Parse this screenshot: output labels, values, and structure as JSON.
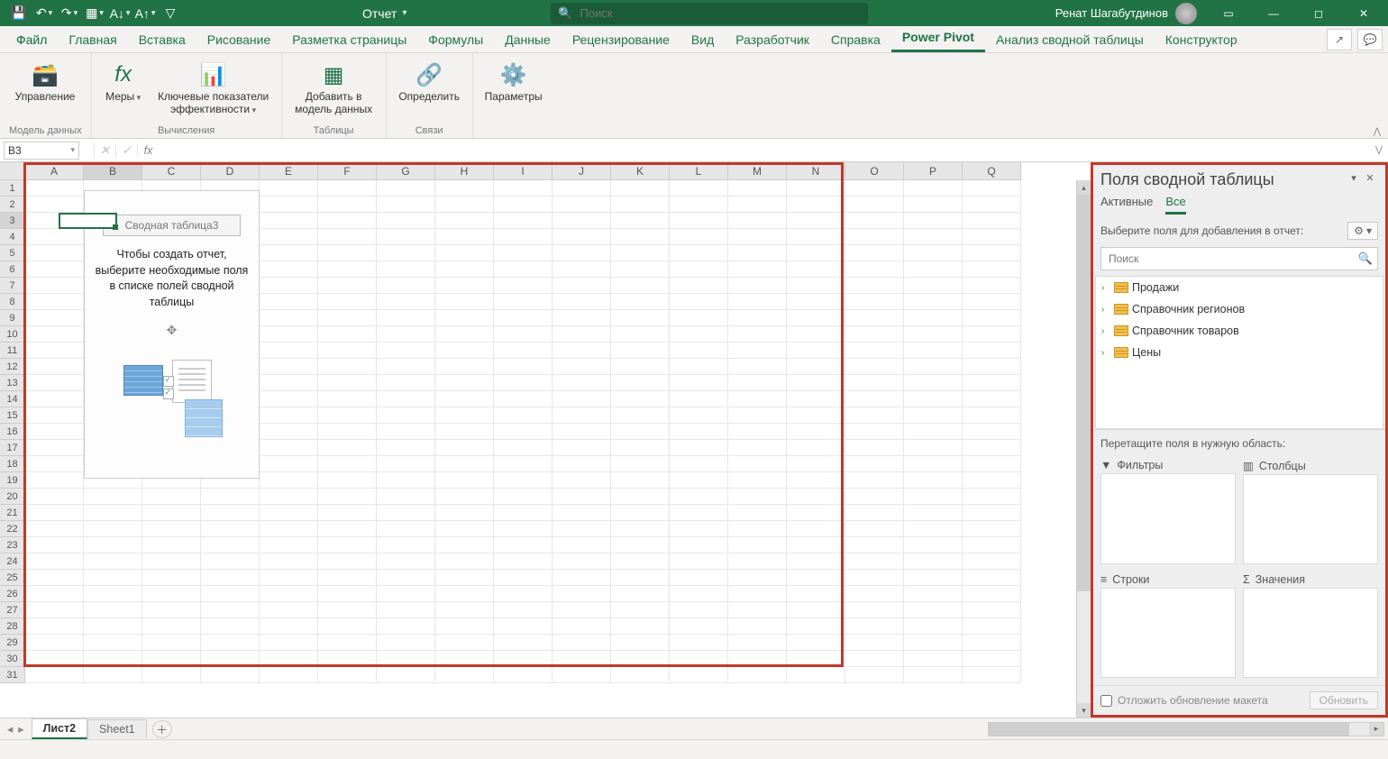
{
  "title": {
    "docname": "Отчет"
  },
  "search": {
    "placeholder": "Поиск"
  },
  "user": {
    "name": "Ренат Шагабутдинов"
  },
  "tabs": {
    "file": "Файл",
    "home": "Главная",
    "insert": "Вставка",
    "draw": "Рисование",
    "layout": "Разметка страницы",
    "formulas": "Формулы",
    "data": "Данные",
    "review": "Рецензирование",
    "view": "Вид",
    "developer": "Разработчик",
    "help": "Справка",
    "powerpivot": "Power Pivot",
    "ptanalyze": "Анализ сводной таблицы",
    "design": "Конструктор"
  },
  "ribbon": {
    "manage": "Управление",
    "measures": "Меры",
    "kpi1": "Ключевые показатели",
    "kpi2": "эффективности",
    "addmodel1": "Добавить в",
    "addmodel2": "модель данных",
    "detect": "Определить",
    "params": "Параметры",
    "g_model": "Модель данных",
    "g_calc": "Вычисления",
    "g_tables": "Таблицы",
    "g_rel": "Связи"
  },
  "fbar": {
    "ref": "B3",
    "fx": "fx"
  },
  "cols": [
    "A",
    "B",
    "C",
    "D",
    "E",
    "F",
    "G",
    "H",
    "I",
    "J",
    "K",
    "L",
    "M",
    "N",
    "O",
    "P",
    "Q"
  ],
  "pivot": {
    "name": "Сводная таблица3",
    "msg": "Чтобы создать отчет, выберите необходимые поля в списке полей сводной таблицы"
  },
  "pane": {
    "title": "Поля сводной таблицы",
    "tab_active": "Активные",
    "tab_all": "Все",
    "choose": "Выберите поля для добавления в отчет:",
    "search": "Поиск",
    "tables": [
      "Продажи",
      "Справочник регионов",
      "Справочник товаров",
      "Цены"
    ],
    "drag": "Перетащите поля в нужную область:",
    "filters": "Фильтры",
    "columns": "Столбцы",
    "rows": "Строки",
    "values": "Значения",
    "defer": "Отложить обновление макета",
    "update": "Обновить"
  },
  "sheets": {
    "s1": "Лист2",
    "s2": "Sheet1"
  }
}
